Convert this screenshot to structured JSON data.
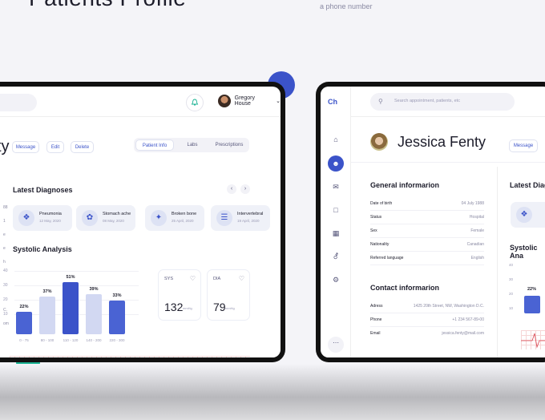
{
  "hero": {
    "title": "Patients Profile",
    "sub": "a phone number"
  },
  "left": {
    "user_name": "Gregory House",
    "name_fragment": "ty",
    "actions": [
      "Message",
      "Edit",
      "Delete"
    ],
    "tabs": [
      "Patient Info",
      "Labs",
      "Prescriptions"
    ],
    "active_tab": "Patient Info",
    "side_values": [
      "88",
      "1",
      "e",
      "e",
      "h",
      "",
      "C.",
      "om"
    ],
    "diagnoses_title": "Latest Diagnoses",
    "diagnoses": [
      {
        "name": "Pneumonia",
        "date": "12 May, 2020",
        "icon": "lungs-icon"
      },
      {
        "name": "Stomach ache",
        "date": "08 May, 2020",
        "icon": "stomach-icon"
      },
      {
        "name": "Broken bone",
        "date": "25 April, 2020",
        "icon": "bone-icon"
      },
      {
        "name": "Intervertebral",
        "date": "19 April, 2020",
        "icon": "spine-icon"
      }
    ],
    "systolic_title": "Systolic Analysis",
    "y_ticks": [
      "40",
      "30",
      "20",
      "10"
    ],
    "vitals": [
      {
        "label": "SYS",
        "value": "132",
        "unit": "mmHg"
      },
      {
        "label": "DIA",
        "value": "79",
        "unit": "mmHg"
      }
    ]
  },
  "chart_data": {
    "type": "bar",
    "categories": [
      "0 - 75",
      "80 - 100",
      "110 - 120",
      "140 - 200",
      "220 - 300"
    ],
    "values": [
      22,
      37,
      51,
      39,
      33
    ],
    "labels": [
      "22%",
      "37%",
      "51%",
      "39%",
      "33%"
    ],
    "colors": [
      "#4a63d3",
      "#d2d8f2",
      "#3b53c9",
      "#d2d8f2",
      "#4a63d3"
    ],
    "title": "Systolic Analysis",
    "ylim": [
      0,
      55
    ]
  },
  "right": {
    "logo": "Ch",
    "search_placeholder": "Search appointment, patients, etc",
    "patient_name": "Jessica Fenty",
    "message_label": "Message",
    "general_title": "General informarion",
    "general": [
      {
        "k": "Date of birth",
        "v": "04 July 1988"
      },
      {
        "k": "Status",
        "v": "Hospital"
      },
      {
        "k": "Sex",
        "v": "Female"
      },
      {
        "k": "Nationality",
        "v": "Canadian"
      },
      {
        "k": "Referred language",
        "v": "English"
      }
    ],
    "contact_title": "Contact informarion",
    "contact": [
      {
        "k": "Adress",
        "v": "1425 20th Street, NW, Washington D.C."
      },
      {
        "k": "Phone",
        "v": "+1 234 567-89-00"
      },
      {
        "k": "Email",
        "v": "jessica.fenty@mail.com"
      }
    ],
    "frag_diag": "Latest Diag",
    "frag_sys": "Systolic Ana",
    "frag_bar": "22%",
    "frag_ticks": [
      "40",
      "30",
      "20",
      "10"
    ]
  }
}
